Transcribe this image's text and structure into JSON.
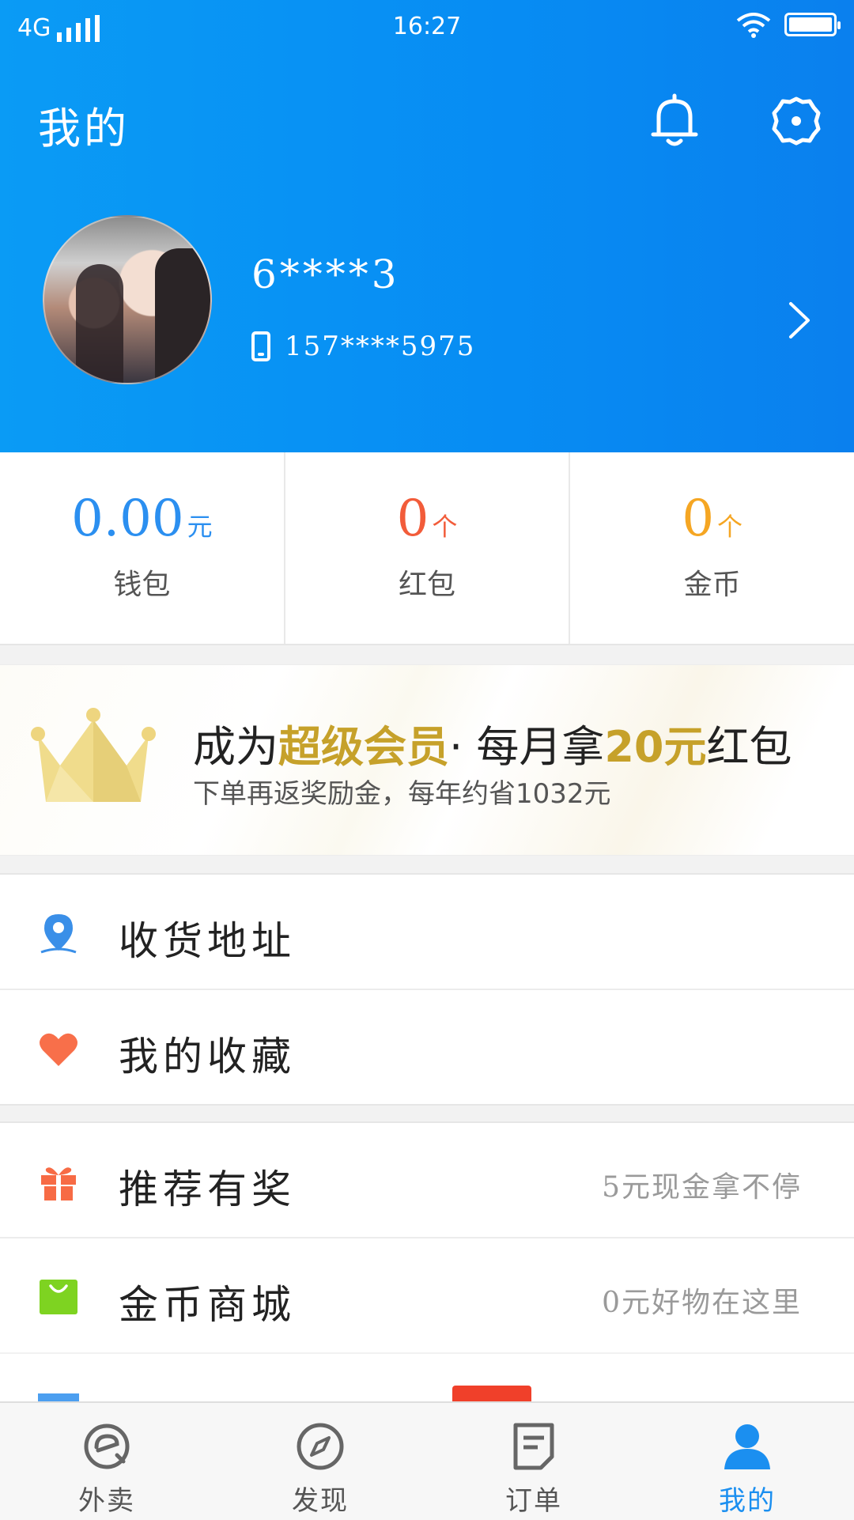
{
  "status": {
    "network": "4G",
    "time": "16:27"
  },
  "header": {
    "title": "我的",
    "username": "6****3",
    "phone": "157****5975"
  },
  "stats": [
    {
      "value": "0.00",
      "unit": "元",
      "label": "钱包",
      "color": "#2b8ff0"
    },
    {
      "value": "0",
      "unit": "个",
      "label": "红包",
      "color": "#f25c3a"
    },
    {
      "value": "0",
      "unit": "个",
      "label": "金币",
      "color": "#f5a623"
    }
  ],
  "banner": {
    "title_pre": "成为",
    "title_gold1": "超级会员",
    "title_mid": "· 每月拿",
    "title_gold2": "20元",
    "title_post": "红包",
    "subtitle": "下单再返奖励金，每年约省1032元"
  },
  "menu_group1": [
    {
      "label": "收货地址",
      "icon": "location-pin-icon"
    },
    {
      "label": "我的收藏",
      "icon": "heart-icon"
    }
  ],
  "menu_group2": [
    {
      "label": "推荐有奖",
      "hint": "5元现金拿不停",
      "icon": "gift-icon"
    },
    {
      "label": "金币商城",
      "hint": "0元好物在这里",
      "icon": "shopping-bag-icon"
    }
  ],
  "tabs": [
    {
      "label": "外卖",
      "icon": "takeout-icon"
    },
    {
      "label": "发现",
      "icon": "compass-icon"
    },
    {
      "label": "订单",
      "icon": "order-icon"
    },
    {
      "label": "我的",
      "icon": "profile-icon",
      "active": true
    }
  ],
  "colors": {
    "header_blue": "#0a9bf5",
    "gold": "#c6a12a",
    "active_tab": "#1b8ff0"
  }
}
